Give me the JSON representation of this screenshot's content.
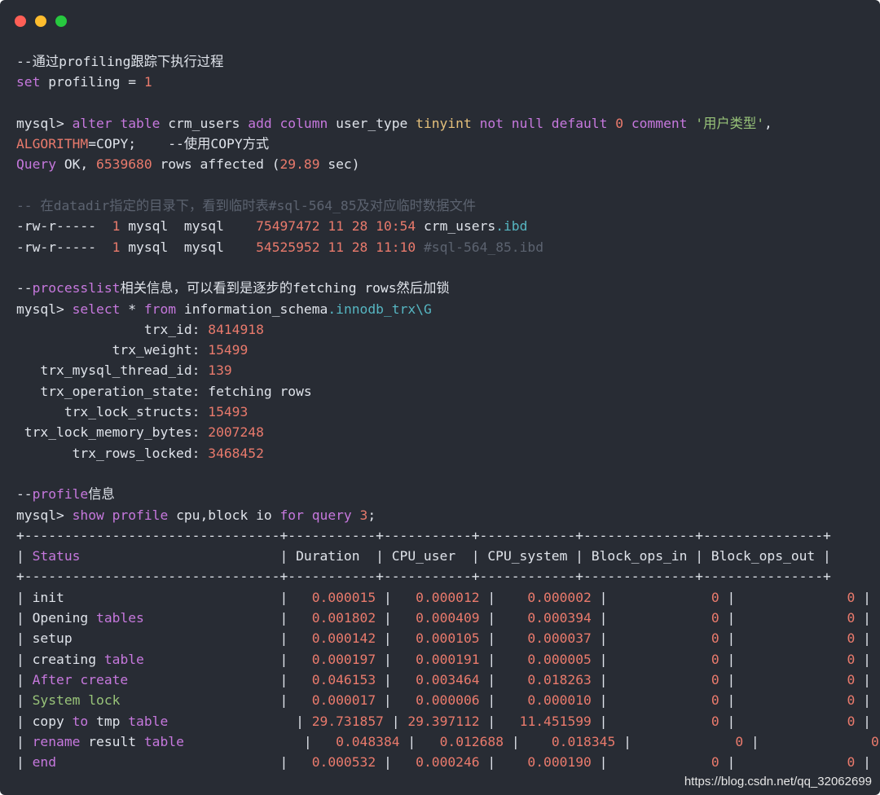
{
  "window": {
    "controls": [
      {
        "name": "close",
        "color": "#ff5f56"
      },
      {
        "name": "minimize",
        "color": "#ffbd2e"
      },
      {
        "name": "zoom",
        "color": "#27c93f"
      }
    ]
  },
  "code": {
    "profiling_comment": "--通过profiling跟踪下执行过程",
    "set_kw": "set",
    "set_rest": " profiling = ",
    "set_val": "1",
    "alter_prompt": "mysql> ",
    "alter_kw1": "alter table",
    "alter_t1": " crm_users ",
    "alter_kw2": "add column",
    "alter_t2": " user_type ",
    "alter_type": "tinyint",
    "alter_sp1": " ",
    "alter_kw3": "not null default",
    "alter_sp2": " ",
    "alter_default": "0",
    "alter_sp3": " ",
    "alter_kw4": "comment",
    "alter_sp4": " ",
    "alter_comment": "'用户类型'",
    "alter_end": ",",
    "algo_kw": "ALGORITHM",
    "algo_rest": "=COPY;    --使用COPY方式",
    "query_kw": "Query",
    "query_t1": " OK, ",
    "query_rows": "6539680",
    "query_t2": " rows affected (",
    "query_time": "29.89",
    "query_t3": " sec)",
    "datadir_comment": "-- 在datadir指定的目录下，看到临时表#sql-564_85及对应临时数据文件",
    "files": [
      {
        "perm": "-rw-r-----  ",
        "links": "1",
        "owner": " mysql  mysql    ",
        "size": "75497472",
        "date": " 11 28 ",
        "time": "10:54",
        "name_pre": " crm_users",
        "name_ext": ".ibd"
      },
      {
        "perm": "-rw-r-----  ",
        "links": "1",
        "owner": " mysql  mysql    ",
        "size": "54525952",
        "date": " 11 28 ",
        "time": "11:10",
        "name_pre": " ",
        "name_ext": "#sql-564_85.ibd"
      }
    ],
    "pl_pre": "--",
    "pl_kw": "processlist",
    "pl_rest": "相关信息，可以看到是逐步的fetching rows然后加锁",
    "sel_prompt": "mysql> ",
    "sel_kw1": "select",
    "sel_star": " * ",
    "sel_kw2": "from",
    "sel_schema": " information_schema",
    "sel_tbl": ".innodb_trx\\G",
    "trx_fields": [
      {
        "label": "                trx_id: ",
        "value": "8414918",
        "numeric": true
      },
      {
        "label": "            trx_weight: ",
        "value": "15499",
        "numeric": true
      },
      {
        "label": "   trx_mysql_thread_id: ",
        "value": "139",
        "numeric": true
      },
      {
        "label": "   trx_operation_state: ",
        "value": "fetching rows",
        "numeric": false
      },
      {
        "label": "      trx_lock_structs: ",
        "value": "15493",
        "numeric": true
      },
      {
        "label": " trx_lock_memory_bytes: ",
        "value": "2007248",
        "numeric": true
      },
      {
        "label": "       trx_rows_locked: ",
        "value": "3468452",
        "numeric": true
      }
    ],
    "prof_pre": "--",
    "prof_kw": "profile",
    "prof_rest": "信息",
    "show_prompt": "mysql> ",
    "show_kw1": "show profile",
    "show_t1": " cpu,block io ",
    "show_kw2": "for query",
    "show_sp": " ",
    "show_n": "3",
    "show_end": ";",
    "table_border": "+--------------------------------+-----------+-----------+------------+--------------+---------------+",
    "header_open": "| ",
    "header_status": "Status",
    "header_rest": "                         | Duration  | CPU_user  | CPU_system | Block_ops_in | Block_ops_out |",
    "rows": [
      {
        "s1": "init",
        "s1c": "plain",
        "s2": "",
        "s2c": "plain",
        "pad": "                           ",
        "duration": "  0.000015",
        "cpu_user": "  0.000012",
        "cpu_system": "   0.000002",
        "ops_in": "            0",
        "ops_out": "             0"
      },
      {
        "s1": "Opening",
        "s1c": "plain",
        "s2": " tables",
        "s2c": "kw",
        "pad": "                 ",
        "duration": "  0.001802",
        "cpu_user": "  0.000409",
        "cpu_system": "   0.000394",
        "ops_in": "            0",
        "ops_out": "             0"
      },
      {
        "s1": "setup",
        "s1c": "plain",
        "s2": "",
        "s2c": "plain",
        "pad": "                          ",
        "duration": "  0.000142",
        "cpu_user": "  0.000105",
        "cpu_system": "   0.000037",
        "ops_in": "            0",
        "ops_out": "             0"
      },
      {
        "s1": "creating",
        "s1c": "plain",
        "s2": " table",
        "s2c": "kw",
        "pad": "                 ",
        "duration": "  0.000197",
        "cpu_user": "  0.000191",
        "cpu_system": "   0.000005",
        "ops_in": "            0",
        "ops_out": "             0"
      },
      {
        "s1": "After create",
        "s1c": "kw",
        "s2": "",
        "s2c": "plain",
        "pad": "                   ",
        "duration": "  0.046153",
        "cpu_user": "  0.003464",
        "cpu_system": "   0.018263",
        "ops_in": "            0",
        "ops_out": "             0"
      },
      {
        "s1": "System lock",
        "s1c": "str",
        "s2": "",
        "s2c": "plain",
        "pad": "                    ",
        "duration": "  0.000017",
        "cpu_user": "  0.000006",
        "cpu_system": "   0.000010",
        "ops_in": "            0",
        "ops_out": "             0"
      },
      {
        "s1": "copy ",
        "s1c": "plain",
        "s2": "to",
        "s2c": "kw",
        "s3": " tmp ",
        "s4": "table",
        "pad": "                ",
        "duration": "29.731857",
        "cpu_user": "29.397112",
        "cpu_system": "  11.451599",
        "ops_in": "            0",
        "ops_out": "             0"
      },
      {
        "s1": "rename",
        "s1c": "kw",
        "s2": " result ",
        "s2c": "plain",
        "s4": "table",
        "pad": "               ",
        "duration": "  0.048384",
        "cpu_user": "  0.012688",
        "cpu_system": "   0.018345",
        "ops_in": "            0",
        "ops_out": "             0"
      },
      {
        "s1": "end",
        "s1c": "kw",
        "s2": "",
        "s2c": "plain",
        "pad": "                            ",
        "duration": "  0.000532",
        "cpu_user": "  0.000246",
        "cpu_system": "   0.000190",
        "ops_in": "            0",
        "ops_out": "             0"
      }
    ]
  },
  "watermark": "https://blog.csdn.net/qq_32062699"
}
